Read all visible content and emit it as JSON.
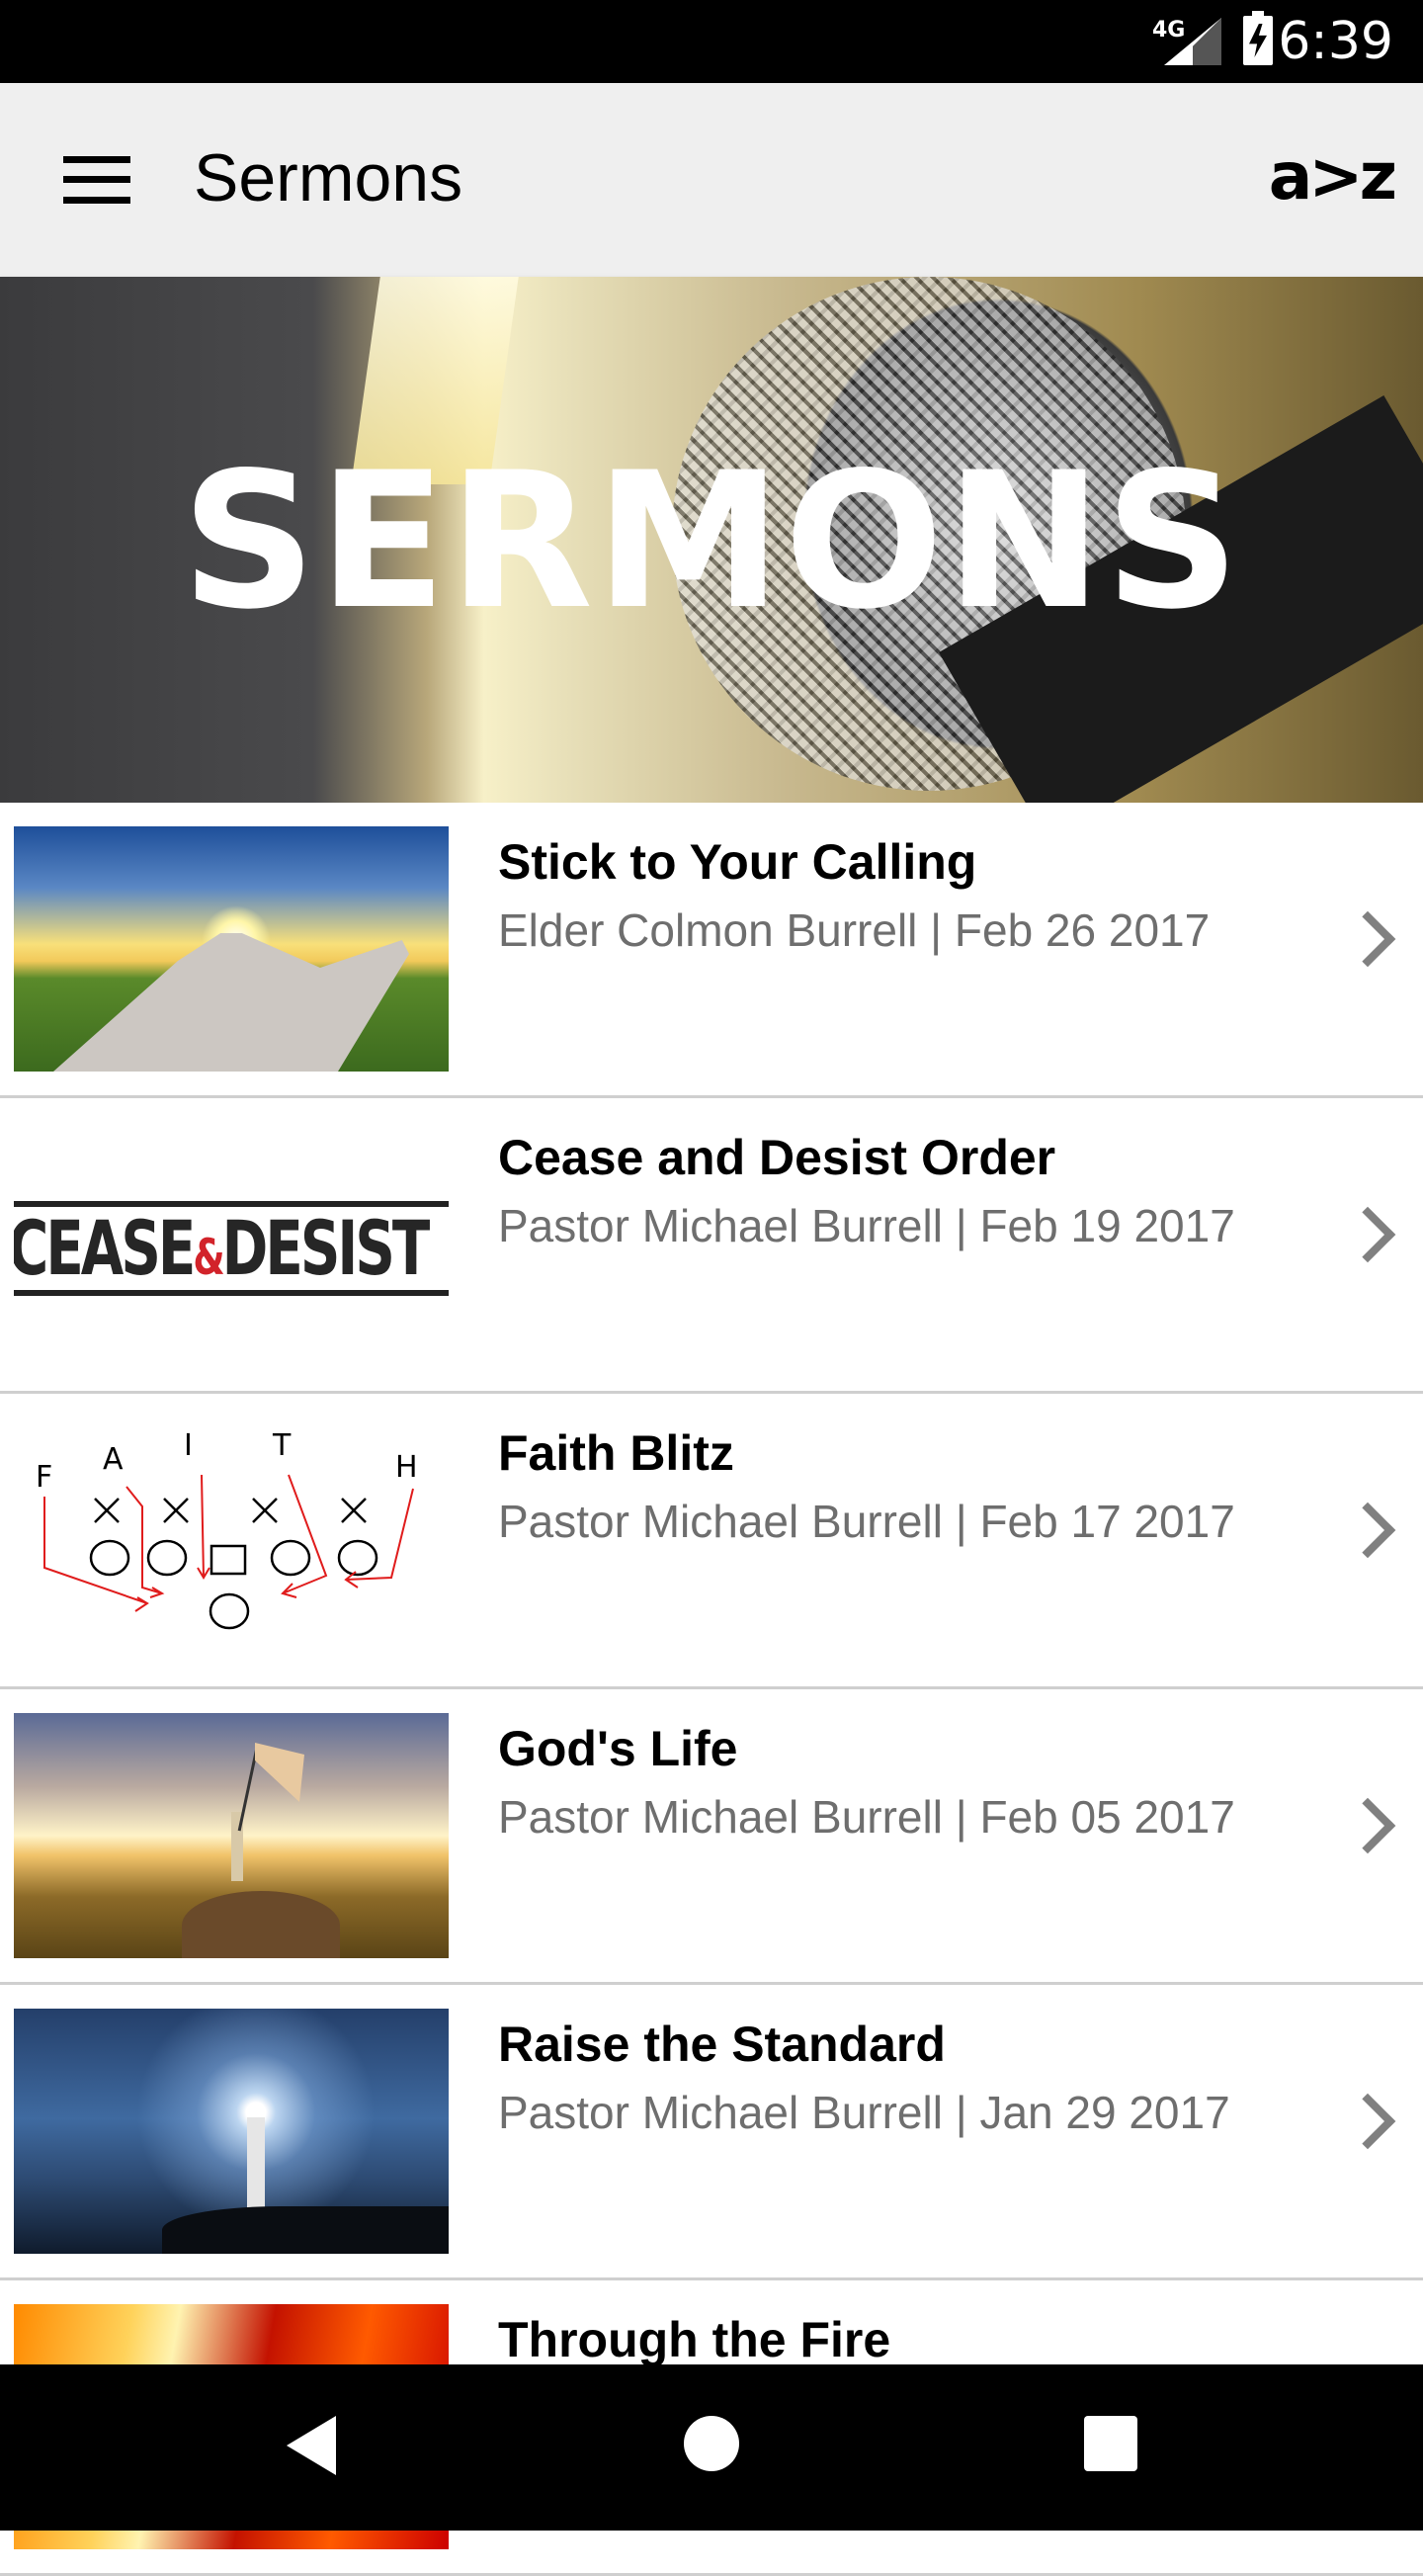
{
  "status_bar": {
    "network": "4G",
    "time": "6:39",
    "icons": [
      "signal-icon",
      "battery-charging-icon"
    ]
  },
  "toolbar": {
    "menu_icon": "hamburger-menu-icon",
    "title": "Sermons",
    "sort_label": "a>z"
  },
  "hero": {
    "title": "SERMONS",
    "image": "microphone-banner"
  },
  "sermons": [
    {
      "title": "Stick to Your Calling",
      "subtitle": "Elder Colmon Burrell | Feb 26 2017",
      "thumbnail": "crossroads-sunset"
    },
    {
      "title": "Cease and Desist Order",
      "subtitle": "Pastor Michael Burrell | Feb 19 2017",
      "thumbnail": "cease-and-desist-logo",
      "thumb_text_a": "CEASE",
      "thumb_text_amp": "&",
      "thumb_text_b": "DESIST"
    },
    {
      "title": "Faith Blitz",
      "subtitle": "Pastor Michael Burrell | Feb 17 2017",
      "thumbnail": "football-play-diagram",
      "thumb_letters": [
        "F",
        "A",
        "I",
        "T",
        "H"
      ]
    },
    {
      "title": "God's Life",
      "subtitle": "Pastor Michael Burrell | Feb 05 2017",
      "thumbnail": "person-with-flag-on-hill"
    },
    {
      "title": "Raise the Standard",
      "subtitle": "Pastor Michael Burrell | Jan 29 2017",
      "thumbnail": "lighthouse"
    },
    {
      "title": "Through the Fire",
      "subtitle": "",
      "thumbnail": "fire"
    }
  ],
  "nav_bar": {
    "back": "back-icon",
    "home": "home-icon",
    "recents": "recents-icon"
  }
}
